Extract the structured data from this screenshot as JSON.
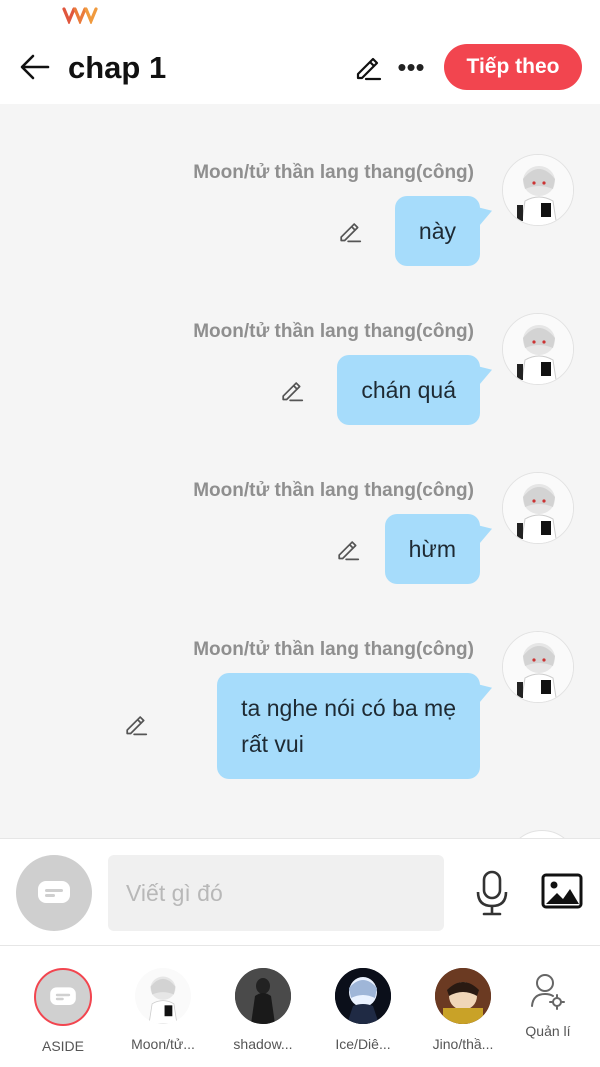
{
  "status_bar": {
    "carrier_logo": "viettel-logo"
  },
  "header": {
    "title": "chap 1",
    "back_icon": "arrow-left-icon",
    "edit_icon": "pencil-icon",
    "more_icon": "more-horizontal-icon",
    "more_label": "•••",
    "next_button": "Tiếp theo",
    "accent_color": "#f2454f"
  },
  "messages": [
    {
      "author": "Moon/tử thần lang thang(công)",
      "text": "này"
    },
    {
      "author": "Moon/tử thần lang thang(công)",
      "text": "chán quá"
    },
    {
      "author": "Moon/tử thần lang thang(công)",
      "text": "hừm"
    },
    {
      "author": "Moon/tử thần lang thang(công)",
      "text": "ta nghe nói có ba mẹ\nrất vui"
    }
  ],
  "composer": {
    "placeholder": "Viết gì đó",
    "mic_icon": "microphone-icon",
    "image_icon": "image-icon"
  },
  "characters": [
    {
      "label": "ASIDE"
    },
    {
      "label": "Moon/tử..."
    },
    {
      "label": "shadow..."
    },
    {
      "label": "Ice/Diê..."
    },
    {
      "label": "Jino/thầ..."
    }
  ],
  "manage": {
    "label": "Quản lí",
    "icon": "user-settings-icon"
  },
  "bubble_color": "#a6dcfb"
}
